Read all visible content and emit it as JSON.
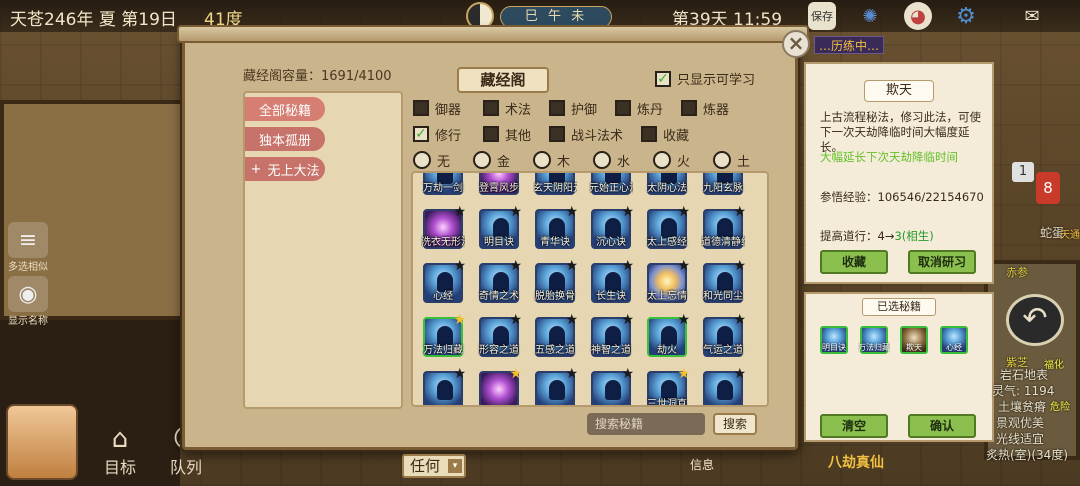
{
  "status_bar": {
    "date": "天苍246年 夏 第19日",
    "temperature": "41度",
    "time_period": "巳 午 未",
    "day_time": "第39天 11:59",
    "save_label": "保存"
  },
  "left_tools": {
    "multi_select": "多选相似",
    "show_names": "显示名称"
  },
  "bottom": {
    "target_label": "目标",
    "team_label": "队列",
    "any_label": "任何",
    "info_label": "信息",
    "realm_label": "八劫真仙"
  },
  "window": {
    "capacity": "藏经阁容量：1691/4100",
    "title": "藏经阁",
    "only_learnable": "只显示可学习",
    "categories": [
      "全部秘籍",
      "独本孤册",
      "无上大法"
    ],
    "filter_row1": [
      "御器",
      "术法",
      "护御",
      "炼丹",
      "炼器"
    ],
    "filter_row2": [
      "修行",
      "其他",
      "战斗法术",
      "收藏"
    ],
    "elements": [
      "无",
      "金",
      "木",
      "水",
      "火",
      "土"
    ],
    "search_placeholder": "搜索秘籍",
    "search_button": "搜索",
    "close_label": "×",
    "overlay_tag": "…历练中…"
  },
  "book_grid": {
    "row0": [
      "万劫一剑",
      "登霄风步",
      "玄天阴阳元气",
      "元始正心法",
      "太阴心法",
      "九阳玄脉"
    ],
    "row1": [
      "洗衣无形流",
      "明目诀",
      "青华诀",
      "沉心诀",
      "太上感经",
      "道德清静经"
    ],
    "row2": [
      "心经",
      "奇情之术",
      "脱胎换骨",
      "长生诀",
      "太上忘情",
      "和光同尘"
    ],
    "row3": [
      "万法归藏",
      "形容之道",
      "五感之道",
      "神智之道",
      "劫火",
      "气运之道"
    ],
    "row4": [
      "",
      "",
      "",
      "",
      "三世洞真",
      ""
    ]
  },
  "detail": {
    "title": "欺天",
    "description": "上古流程秘法，修习此法，可使下一次天劫降临时间大幅度延长。",
    "effect": "大幅延长下次天劫降临时间",
    "exp": "参悟经验：106546/22154670",
    "improve_prefix": "提高道行：4→",
    "improve_value": "3(相生)",
    "collect_button": "收藏",
    "cancel_button": "取消研习"
  },
  "selected": {
    "title": "已选秘籍",
    "items": [
      "明目诀",
      "万法归藏",
      "欺天",
      "心经"
    ],
    "clear_button": "清空",
    "confirm_button": "确认"
  },
  "map_edge": {
    "badge_1": "1",
    "badge_8": "8",
    "egg": "蛇蛋",
    "tian": "天通",
    "chishen": "赤参",
    "zhi": "紫芝",
    "terrain": "岩石地表",
    "lingqi": "灵气: 1194",
    "soil": "土壤贫瘠",
    "view": "景观优美",
    "light": "光线适宜",
    "heat": "炙热(室)(34度)",
    "fuhua": "福化",
    "danger": "危险",
    "fire": "炎热"
  }
}
